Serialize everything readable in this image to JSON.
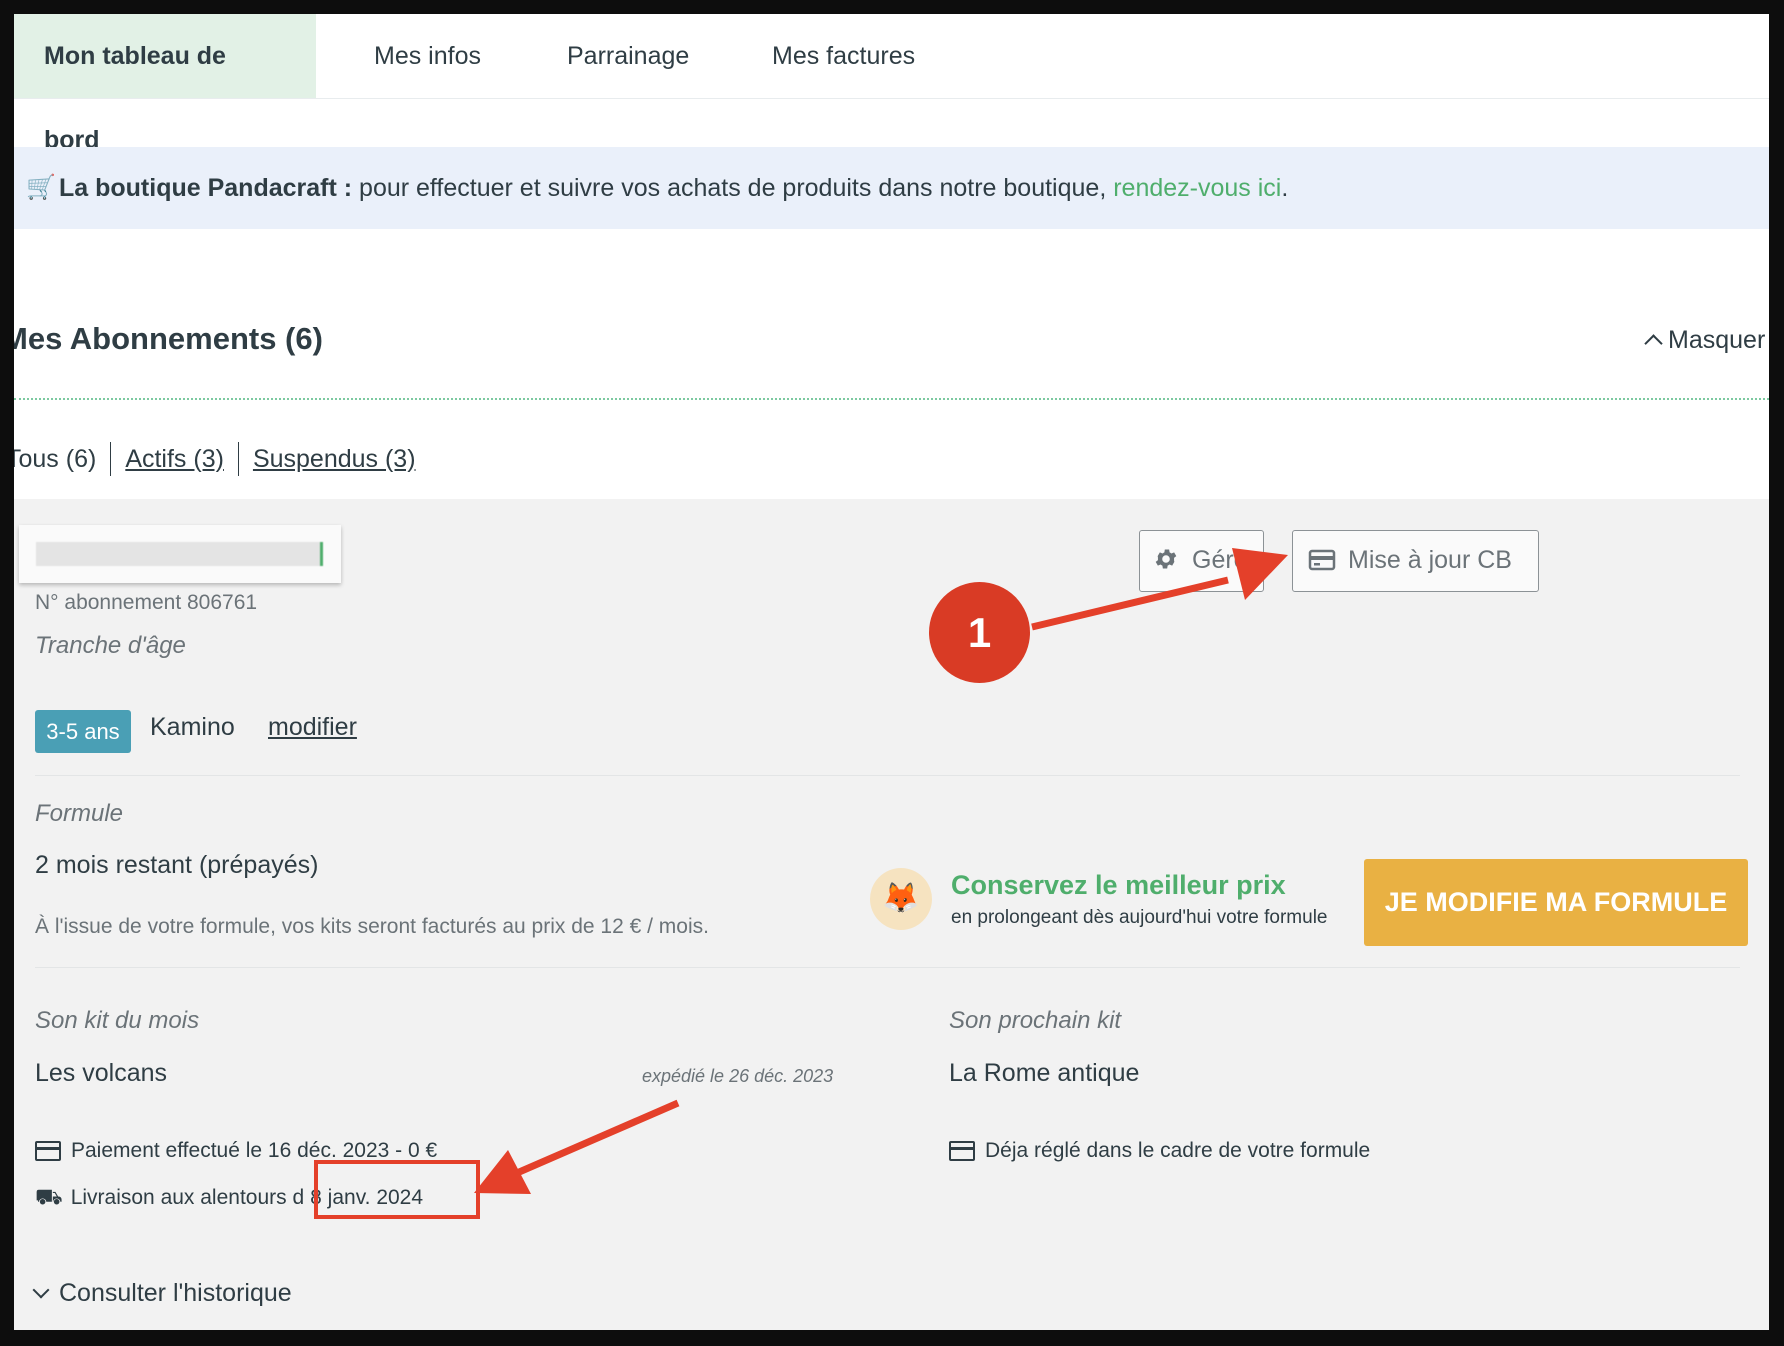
{
  "nav": {
    "tabs": [
      {
        "label": "Mon tableau de bord",
        "active": true
      },
      {
        "label": "Mes infos",
        "active": false
      },
      {
        "label": "Parrainage",
        "active": false
      },
      {
        "label": "Mes factures",
        "active": false
      }
    ]
  },
  "banner": {
    "icon": "shopping-cart-icon",
    "bold": "La boutique Pandacraft :",
    "text": " pour effectuer et suivre vos achats de produits dans notre boutique, ",
    "link": "rendez-vous ici",
    "end": "."
  },
  "subscriptions": {
    "title": "Mes Abonnements (6)",
    "toggle_label": "Masquer",
    "filters": {
      "all": "Tous (6)",
      "active": "Actifs (3)",
      "suspended": "Suspendus (3)"
    }
  },
  "card": {
    "subscription_number": "N° abonnement 806761",
    "manage_button": "Gérer",
    "update_card_button": "Mise à jour CB",
    "age_range_label": "Tranche d'âge",
    "age_badge": "3-5 ans",
    "child_name": "Kamino",
    "modify_link": "modifier",
    "formula_label": "Formule",
    "formula_value": "2 mois restant (prépayés)",
    "formula_note": "À l'issue de votre formule, vos kits seront facturés au prix de 12 € / mois.",
    "promo_title": "Conservez le meilleur prix",
    "promo_sub": "en prolongeant dès aujourd'hui votre formule",
    "cta_button": "JE MODIFIE MA FORMULE",
    "current_kit_label": "Son kit du mois",
    "current_kit": "Les volcans",
    "shipped": "expédié le 26 déc. 2023",
    "payment": "Paiement effectué le 16 déc. 2023 - 0 €",
    "delivery_prefix": "Livraison aux alentours d",
    "delivery_date": "8 janv. 2024",
    "next_kit_label": "Son prochain kit",
    "next_kit": "La Rome antique",
    "next_payment": "Déja réglé dans le cadre de votre formule",
    "history_link": "Consulter l'historique"
  },
  "annotations": {
    "step_number": "1",
    "color": "#e4402a"
  }
}
